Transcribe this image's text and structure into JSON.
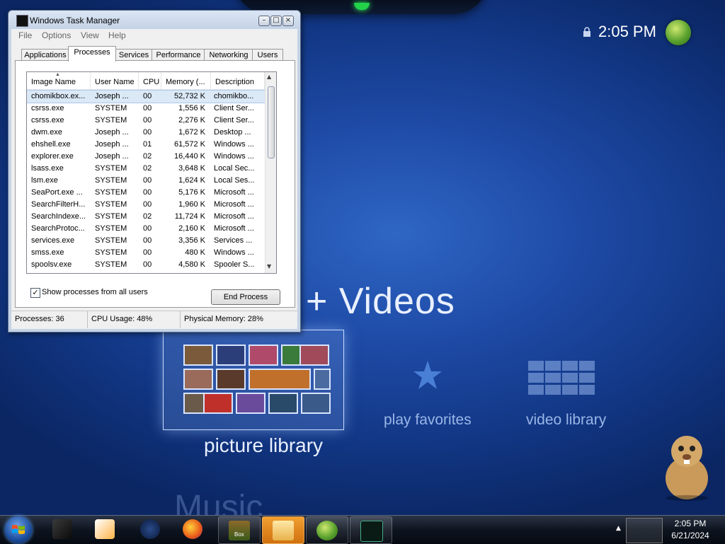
{
  "media_center": {
    "clock": "2:05 PM",
    "section_title": "+ Videos",
    "next_section": "Music",
    "tiles": [
      {
        "label": "picture library",
        "selected": true
      },
      {
        "label": "play favorites"
      },
      {
        "label": "video library"
      }
    ]
  },
  "task_manager": {
    "title": "Windows Task Manager",
    "menu": [
      "File",
      "Options",
      "View",
      "Help"
    ],
    "tabs": [
      "Applications",
      "Processes",
      "Services",
      "Performance",
      "Networking",
      "Users"
    ],
    "active_tab": "Processes",
    "columns": [
      "Image Name",
      "User Name",
      "CPU",
      "Memory (...",
      "Description"
    ],
    "rows": [
      [
        "chomikbox.ex...",
        "Joseph ...",
        "00",
        "52,732 K",
        "chomikbo..."
      ],
      [
        "csrss.exe",
        "SYSTEM",
        "00",
        "1,556 K",
        "Client Ser..."
      ],
      [
        "csrss.exe",
        "SYSTEM",
        "00",
        "2,276 K",
        "Client Ser..."
      ],
      [
        "dwm.exe",
        "Joseph ...",
        "00",
        "1,672 K",
        "Desktop ..."
      ],
      [
        "ehshell.exe",
        "Joseph ...",
        "01",
        "61,572 K",
        "Windows ..."
      ],
      [
        "explorer.exe",
        "Joseph ...",
        "02",
        "16,440 K",
        "Windows ..."
      ],
      [
        "lsass.exe",
        "SYSTEM",
        "02",
        "3,648 K",
        "Local Sec..."
      ],
      [
        "lsm.exe",
        "SYSTEM",
        "00",
        "1,624 K",
        "Local Ses..."
      ],
      [
        "SeaPort.exe ...",
        "SYSTEM",
        "00",
        "5,176 K",
        "Microsoft ..."
      ],
      [
        "SearchFilterH...",
        "SYSTEM",
        "00",
        "1,960 K",
        "Microsoft ..."
      ],
      [
        "SearchIndexe...",
        "SYSTEM",
        "02",
        "11,724 K",
        "Microsoft ..."
      ],
      [
        "SearchProtoc...",
        "SYSTEM",
        "00",
        "2,160 K",
        "Microsoft ..."
      ],
      [
        "services.exe",
        "SYSTEM",
        "00",
        "3,356 K",
        "Services ..."
      ],
      [
        "smss.exe",
        "SYSTEM",
        "00",
        "480 K",
        "Windows ..."
      ],
      [
        "spoolsv.exe",
        "SYSTEM",
        "00",
        "4,580 K",
        "Spooler S..."
      ]
    ],
    "show_all_label": "Show processes from all users",
    "show_all_checked": true,
    "end_process_label": "End Process",
    "status": {
      "processes": "Processes: 36",
      "cpu": "CPU Usage: 48%",
      "memory": "Physical Memory: 28%"
    }
  },
  "taskbar": {
    "time": "2:05 PM",
    "date": "6/21/2024",
    "thumb_label": "Box"
  },
  "colors": {
    "mc_background": "#1f4ca8",
    "selection": "#dbe9f7",
    "taskbar": "#0e141f"
  }
}
